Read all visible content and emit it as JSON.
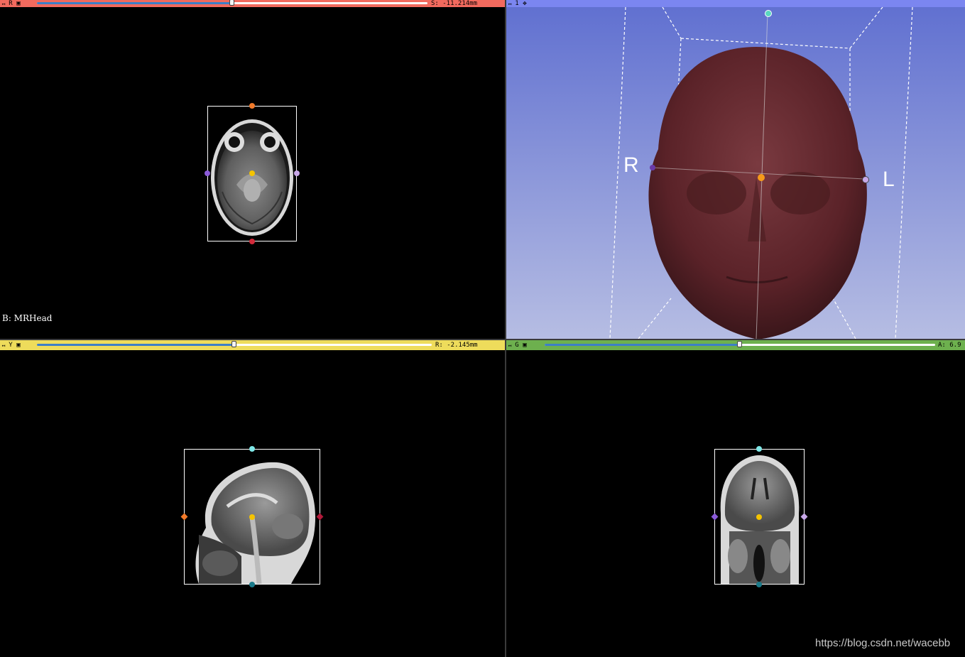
{
  "red_view": {
    "view_label": "R",
    "pin_icon": "pin-icon",
    "link_icon": "link-icon",
    "slider_value": 0.5,
    "offset_text": "S: -11.214mm",
    "volume_label": "B: MRHead",
    "bar_color": "#f26a5e",
    "slider_color": "#3d7fc7"
  },
  "threed_view": {
    "view_label": "1",
    "pin_icon": "pin-icon",
    "center_icon": "crosshair-center-icon",
    "orient_left": "R",
    "orient_right": "L",
    "bar_color": "#7b86f0",
    "background_top": "#5f6fd0",
    "background_bottom": "#b6bde3",
    "head_color": "#5a2228"
  },
  "yellow_view": {
    "view_label": "Y",
    "pin_icon": "pin-icon",
    "link_icon": "link-icon",
    "slider_value": 0.5,
    "offset_text": "R: -2.145mm",
    "bar_color": "#eedc5b"
  },
  "green_view": {
    "view_label": "G",
    "pin_icon": "pin-icon",
    "link_icon": "link-icon",
    "slider_value": 0.5,
    "offset_text": "A: 6.9",
    "bar_color": "#6db04e"
  },
  "watermark": "https://blog.csdn.net/wacebb"
}
